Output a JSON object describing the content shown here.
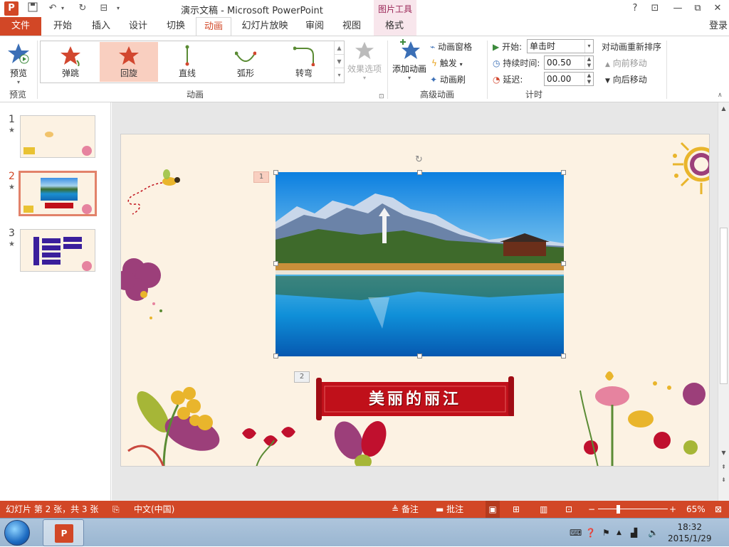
{
  "window": {
    "app_logo": "P",
    "title": "演示文稿 - Microsoft PowerPoint",
    "context_tab": "图片工具",
    "help": "?",
    "restore_icon_glyph": "⊡",
    "minimize": "—",
    "maximize": "⧉",
    "close": "✕"
  },
  "tabs": {
    "file": "文件",
    "items": [
      "开始",
      "插入",
      "设计",
      "切换",
      "动画",
      "幻灯片放映",
      "审阅",
      "视图",
      "格式"
    ],
    "active": "动画",
    "login": "登录"
  },
  "ribbon": {
    "preview": {
      "label": "预览",
      "group": "预览"
    },
    "animations": {
      "group": "动画",
      "items": [
        "弹跳",
        "回旋",
        "直线",
        "弧形",
        "转弯"
      ],
      "selected": "回旋",
      "effect_options": "效果选项"
    },
    "advanced": {
      "group": "高级动画",
      "add_animation": "添加动画",
      "animation_pane": "动画窗格",
      "trigger": "触发",
      "animation_painter": "动画刷"
    },
    "timing": {
      "group": "计时",
      "start_label": "开始:",
      "start_value": "单击时",
      "duration_label": "持续时间:",
      "duration_value": "00.50",
      "delay_label": "延迟:",
      "delay_value": "00.00",
      "reorder_title": "对动画重新排序",
      "move_earlier": "向前移动",
      "move_later": "向后移动"
    }
  },
  "thumbnails": {
    "items": [
      {
        "number": "1",
        "star": "★"
      },
      {
        "number": "2",
        "star": "★"
      },
      {
        "number": "3",
        "star": "★"
      }
    ],
    "selected": "2"
  },
  "slide": {
    "anim_tag_1": "1",
    "anim_tag_2": "2",
    "banner_text": "美丽的丽江"
  },
  "status": {
    "slide_info": "幻灯片 第 2 张，共 3 张",
    "language": "中文(中国)",
    "notes": "备注",
    "comments": "批注",
    "zoom": "65%"
  },
  "taskbar": {
    "time": "18:32",
    "date": "2015/1/29"
  },
  "colors": {
    "accent": "#d24726",
    "selected_animation": "#f9cfc0",
    "banner_red": "#c0101a"
  }
}
